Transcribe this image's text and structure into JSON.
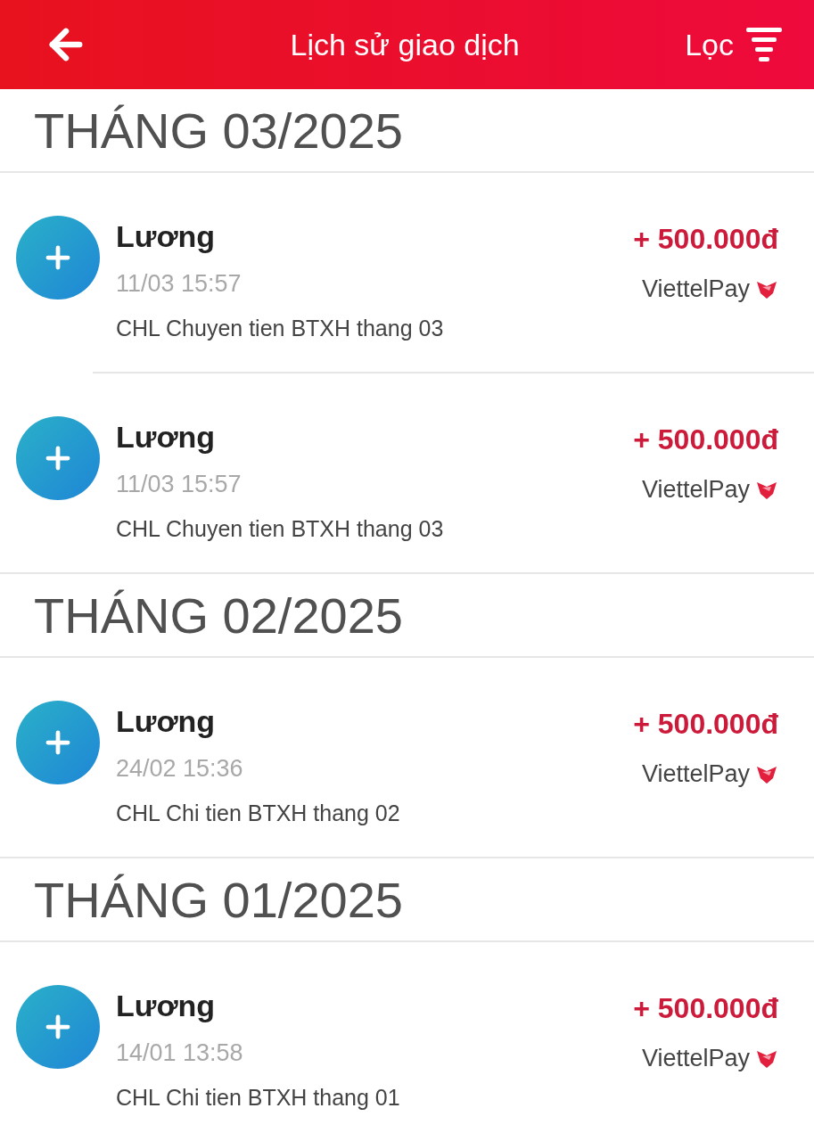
{
  "header": {
    "title": "Lịch sử giao dịch",
    "filter_label": "Lọc"
  },
  "sections": [
    {
      "month": "THÁNG 03/2025",
      "transactions": [
        {
          "title": "Lương",
          "time": "11/03 15:57",
          "description": "CHL Chuyen tien BTXH thang 03",
          "amount": "+ 500.000đ",
          "source": "ViettelPay"
        },
        {
          "title": "Lương",
          "time": "11/03 15:57",
          "description": "CHL Chuyen tien BTXH thang 03",
          "amount": "+ 500.000đ",
          "source": "ViettelPay"
        }
      ]
    },
    {
      "month": "THÁNG 02/2025",
      "transactions": [
        {
          "title": "Lương",
          "time": "24/02 15:36",
          "description": "CHL Chi tien BTXH thang 02",
          "amount": "+ 500.000đ",
          "source": "ViettelPay"
        }
      ]
    },
    {
      "month": "THÁNG 01/2025",
      "transactions": [
        {
          "title": "Lương",
          "time": "14/01 13:58",
          "description": "CHL Chi tien BTXH thang 01",
          "amount": "+ 500.000đ",
          "source": "ViettelPay"
        }
      ]
    }
  ]
}
